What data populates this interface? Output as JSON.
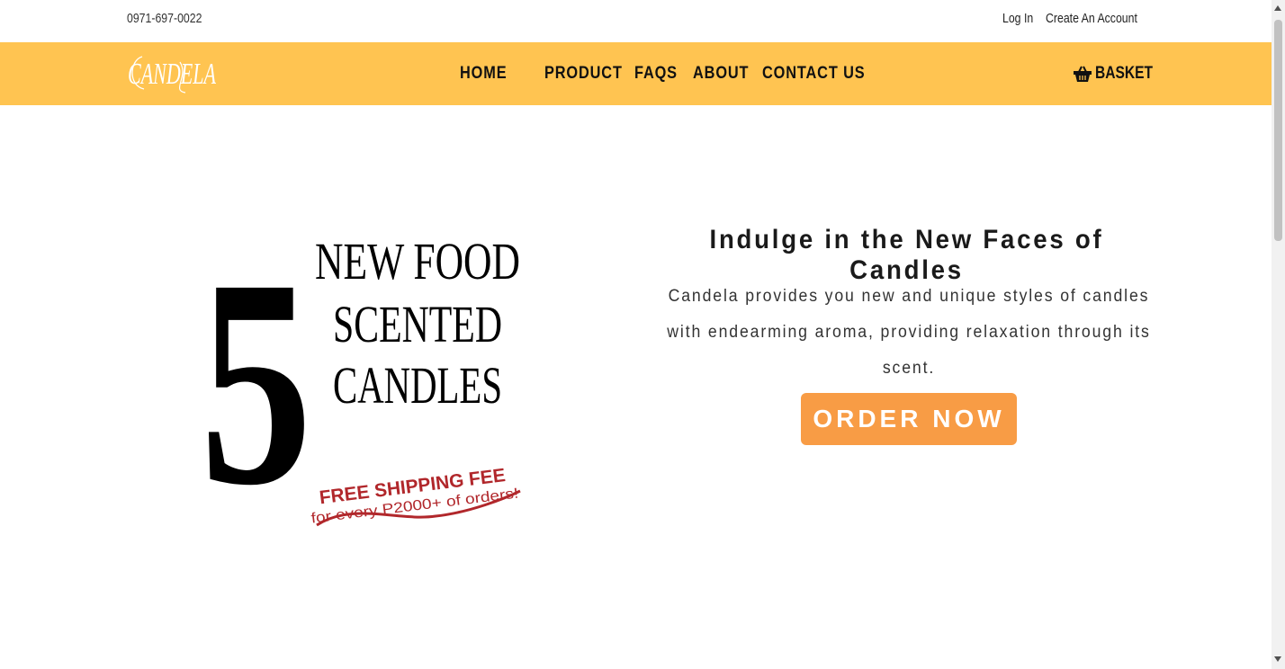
{
  "topbar": {
    "phone": "0971-697-0022",
    "login": "Log In",
    "create_account": "Create An Account"
  },
  "brand": {
    "logo_text": "CANDELA",
    "nav_bg": "#ffc451",
    "accent": "#f89c45"
  },
  "nav": {
    "items": [
      {
        "label": "HOME"
      },
      {
        "label": "PRODUCT"
      },
      {
        "label": "FAQS"
      },
      {
        "label": "ABOUT"
      },
      {
        "label": "CONTACT US"
      }
    ],
    "basket_label": "BASKET",
    "basket_icon": "basket-icon"
  },
  "hero": {
    "art": {
      "number": "5",
      "line1": "NEW FOOD",
      "line2": "SCENTED",
      "line3": "CANDLES",
      "promo1": "FREE SHIPPING FEE",
      "promo2": "for every P2000+ of orders!"
    },
    "title": "Indulge in the New Faces of Candles",
    "description": "Candela provides you new and unique styles of candles with endearming aroma, providing relaxation through its scent.",
    "cta": "ORDER NOW"
  }
}
